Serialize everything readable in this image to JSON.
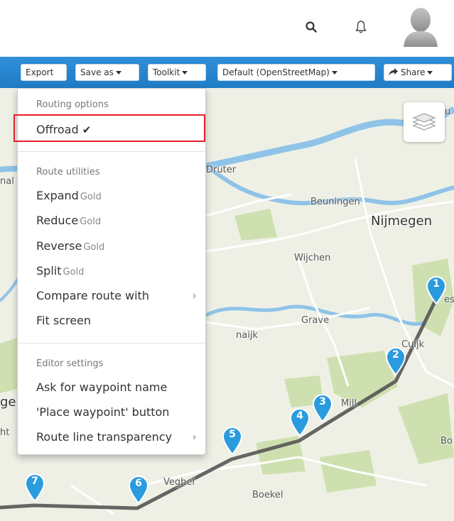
{
  "topbar": {
    "search_icon": "search-icon",
    "bell_icon": "bell-icon",
    "avatar_icon": "user-avatar-icon"
  },
  "toolbar": {
    "export_label": "Export",
    "save_as_label": "Save as",
    "toolkit_label": "Toolkit",
    "map_layer_label": "Default (OpenStreetMap)",
    "share_label": "Share",
    "share_icon": "share-arrow-icon"
  },
  "menu": {
    "routing_header": "Routing options",
    "offroad_label": "Offroad",
    "offroad_check": "✔",
    "utilities_header": "Route utilities",
    "expand_label": "Expand",
    "reduce_label": "Reduce",
    "reverse_label": "Reverse",
    "split_label": "Split",
    "gold_badge": "Gold",
    "compare_label": "Compare route with",
    "fit_label": "Fit screen",
    "editor_header": "Editor settings",
    "ask_waypoint_label": "Ask for waypoint name",
    "place_waypoint_label": "'Place waypoint' button",
    "transparency_label": "Route line transparency"
  },
  "map": {
    "places": {
      "druter": "Druter",
      "beuningen": "Beuningen",
      "nijmegen": "Nijmegen",
      "wijchen": "Wijchen",
      "grave": "Grave",
      "cuijk": "Cuijk",
      "mill": "Mill",
      "veghel": "Veghel",
      "boekel": "Boekel",
      "naijk": "naijk",
      "frag_u": "u",
      "frag_es": "es",
      "frag_bo": "Bo",
      "frag_nal": "nal",
      "frag_ge": "ge",
      "frag_ht": "ht"
    },
    "waypoints": [
      "1",
      "2",
      "3",
      "4",
      "5",
      "6",
      "7"
    ],
    "layers_icon": "layers-icon",
    "route_color": "#555555",
    "marker_color": "#2b9be0"
  }
}
